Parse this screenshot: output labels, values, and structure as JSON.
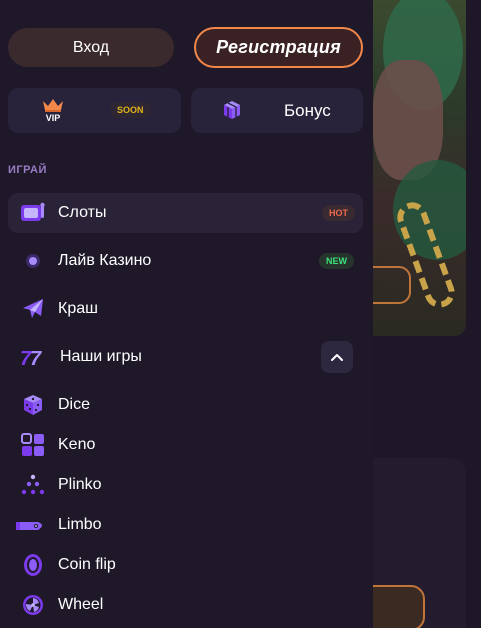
{
  "auth": {
    "login_label": "Вход",
    "register_label": "Регистрация"
  },
  "promo": {
    "vip_text": "VIP",
    "vip_badge": "SOON",
    "bonus_label": "Бонус"
  },
  "section": {
    "title": "ИГРАЙ"
  },
  "nav": {
    "items": [
      {
        "label": "Слоты",
        "badge": "HOT",
        "icon": "slot-machine-icon",
        "active": true
      },
      {
        "label": "Лайв Казино",
        "badge": "NEW",
        "icon": "live-dot-icon"
      },
      {
        "label": "Краш",
        "icon": "plane-icon"
      },
      {
        "label": "Наши игры",
        "icon": "seven-icon",
        "expanded": true
      },
      {
        "label": "Dice",
        "icon": "dice-icon"
      },
      {
        "label": "Keno",
        "icon": "keno-grid-icon"
      },
      {
        "label": "Plinko",
        "icon": "plinko-icon"
      },
      {
        "label": "Limbo",
        "icon": "rocket-icon"
      },
      {
        "label": "Coin flip",
        "icon": "coin-icon"
      },
      {
        "label": "Wheel",
        "icon": "wheel-icon"
      }
    ]
  },
  "colors": {
    "accent_orange": "#f2874a",
    "accent_purple": "#8b5cf6",
    "hot": "#ef6a4a",
    "new": "#3ee07a",
    "soon": "#e0b21c"
  }
}
